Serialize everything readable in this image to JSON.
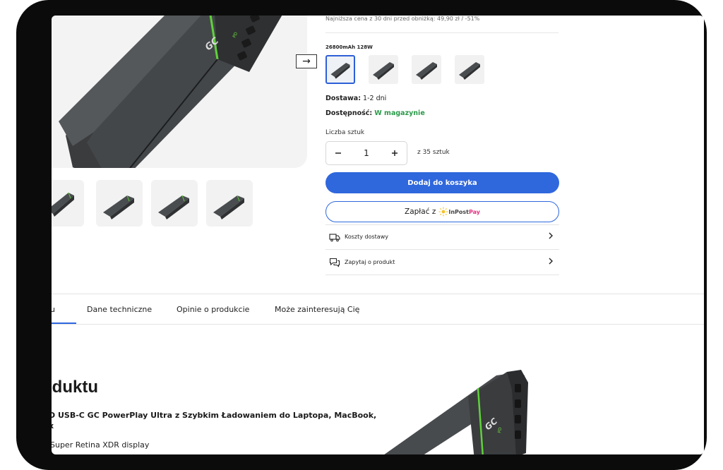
{
  "product": {
    "lowest_price_note": "Najniższa cena z 30 dni przed obniżką: 49,90 zł / -51%",
    "variant_label": "26800mAh 128W",
    "delivery_label": "Dostawa:",
    "delivery_value": "1-2 dni",
    "availability_label": "Dostępność:",
    "availability_value": "W magazynie",
    "quantity_label": "Liczba sztuk",
    "quantity_value": "1",
    "stock_note": "z 35 sztuk",
    "add_to_cart_label": "Dodaj do koszyka",
    "pay_label": "Zapłać z",
    "inpost_brand": "InPost",
    "inpost_pay": "Pay",
    "shipping_cost_label": "Koszty dostawy",
    "ask_label": "Zapytaj o produkt",
    "logo_text": "GC"
  },
  "gallery": {
    "next_arrow": "→"
  },
  "tabs": [
    {
      "label": "u"
    },
    {
      "label": "Dane techniczne"
    },
    {
      "label": "Opinie o produkcie"
    },
    {
      "label": "Może zainteresują Cię"
    }
  ],
  "description": {
    "title": "oduktu",
    "subtitle_line1": "D USB-C GC PowerPlay Ultra z Szybkim Ładowaniem do Laptopa, MacBook,",
    "subtitle_line2": "x",
    "text_line": "Super Retina XDR display"
  },
  "colors": {
    "accent": "#2f67dd",
    "available": "#2b9a4a",
    "inpost_pink": "#e2317f"
  },
  "icons": {
    "next": "arrow-right-icon",
    "truck": "truck-icon",
    "chat": "chat-icon",
    "chevron": "chevron-right-icon"
  }
}
